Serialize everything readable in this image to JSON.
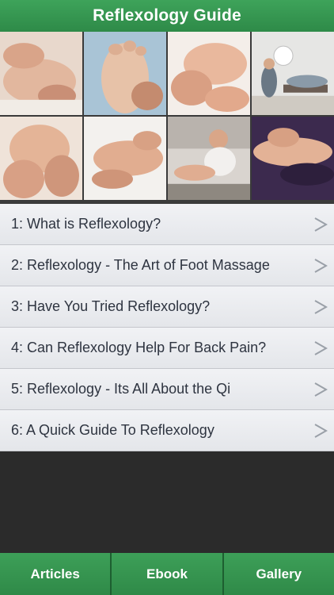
{
  "header": {
    "title": "Reflexology Guide"
  },
  "gallery": {
    "photos": [
      {
        "icon": "hands-on-foot-photo"
      },
      {
        "icon": "sole-of-foot-photo"
      },
      {
        "icon": "toe-massage-photo"
      },
      {
        "icon": "treatment-room-photo"
      },
      {
        "icon": "thumb-pressure-photo"
      },
      {
        "icon": "foot-pressure-photo"
      },
      {
        "icon": "therapist-session-photo"
      },
      {
        "icon": "leg-massage-photo"
      }
    ]
  },
  "articles": [
    {
      "label": "1: What is Reflexology?"
    },
    {
      "label": "2: Reflexology - The Art of Foot Massage"
    },
    {
      "label": "3: Have You Tried Reflexology?"
    },
    {
      "label": "4: Can Reflexology Help For Back Pain?"
    },
    {
      "label": "5: Reflexology - Its All About the Qi"
    },
    {
      "label": "6: A Quick Guide To Reflexology"
    }
  ],
  "chevron": ">",
  "tabs": [
    {
      "label": "Articles"
    },
    {
      "label": "Ebook"
    },
    {
      "label": "Gallery"
    }
  ],
  "colors": {
    "accent": "#2e8a48",
    "background": "#2b2b2b",
    "row": "#e9eaee"
  }
}
